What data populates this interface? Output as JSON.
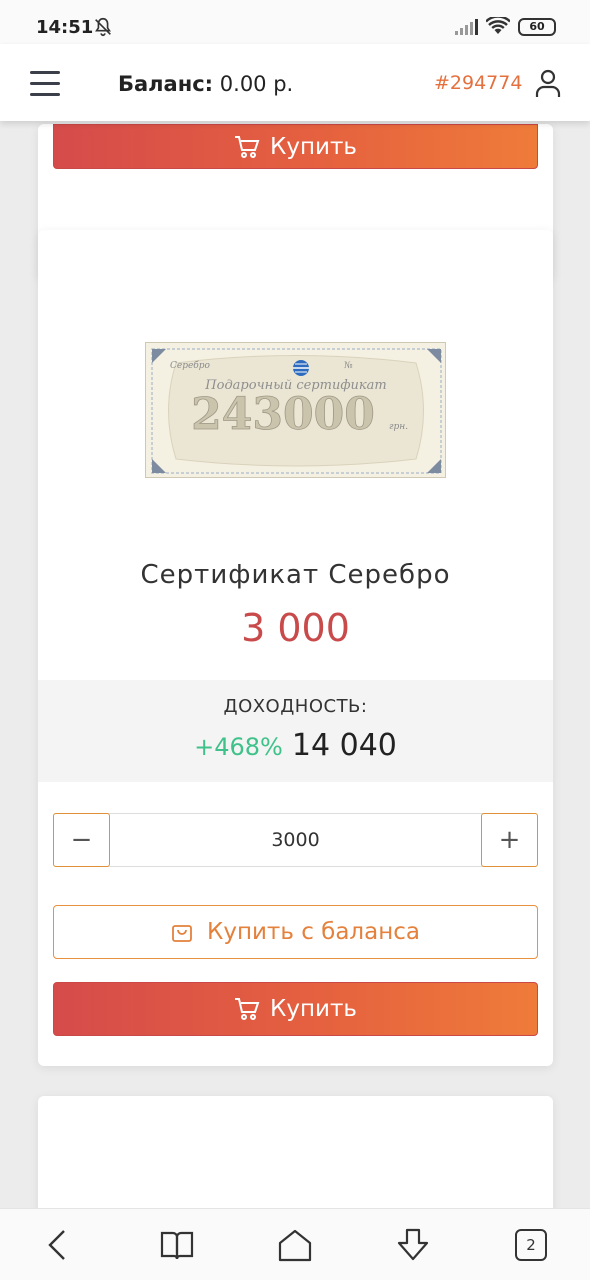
{
  "status_bar": {
    "time": "14:51",
    "battery": "60"
  },
  "header": {
    "balance_label": "Баланс:",
    "balance_value": "0.00 р.",
    "user_id": "#294774"
  },
  "top_card": {
    "buy_label": "Купить"
  },
  "product": {
    "certificate_number_text": "243000",
    "certificate_heading": "Подарочный сертификат",
    "certificate_currency": "грн.",
    "certificate_brand": "Серебро",
    "certificate_no": "№",
    "title": "Сертификат Серебро",
    "price": "3 000",
    "yield_label": "ДОХОДНОСТЬ:",
    "yield_percent": "+468%",
    "yield_amount": "14 040",
    "quantity": "3000",
    "minus_label": "−",
    "plus_label": "+",
    "buy_balance_label": "Купить с баланса",
    "buy_label": "Купить"
  },
  "nav": {
    "tabs_count": "2"
  },
  "colors": {
    "accent_orange": "#e4703e",
    "price_red": "#c94a4a",
    "yield_green": "#3fc28a",
    "button_gradient_start": "#d54b4b",
    "button_gradient_end": "#ef7b3a"
  },
  "icons": {
    "menu": "hamburger-icon",
    "user": "user-icon",
    "cart": "cart-icon",
    "bag": "shopping-bag-icon",
    "back": "back-arrow-icon",
    "bookmarks": "book-icon",
    "home": "home-icon",
    "download": "download-icon",
    "bell_off": "bell-off-icon",
    "signal": "signal-icon",
    "wifi": "wifi-icon"
  }
}
